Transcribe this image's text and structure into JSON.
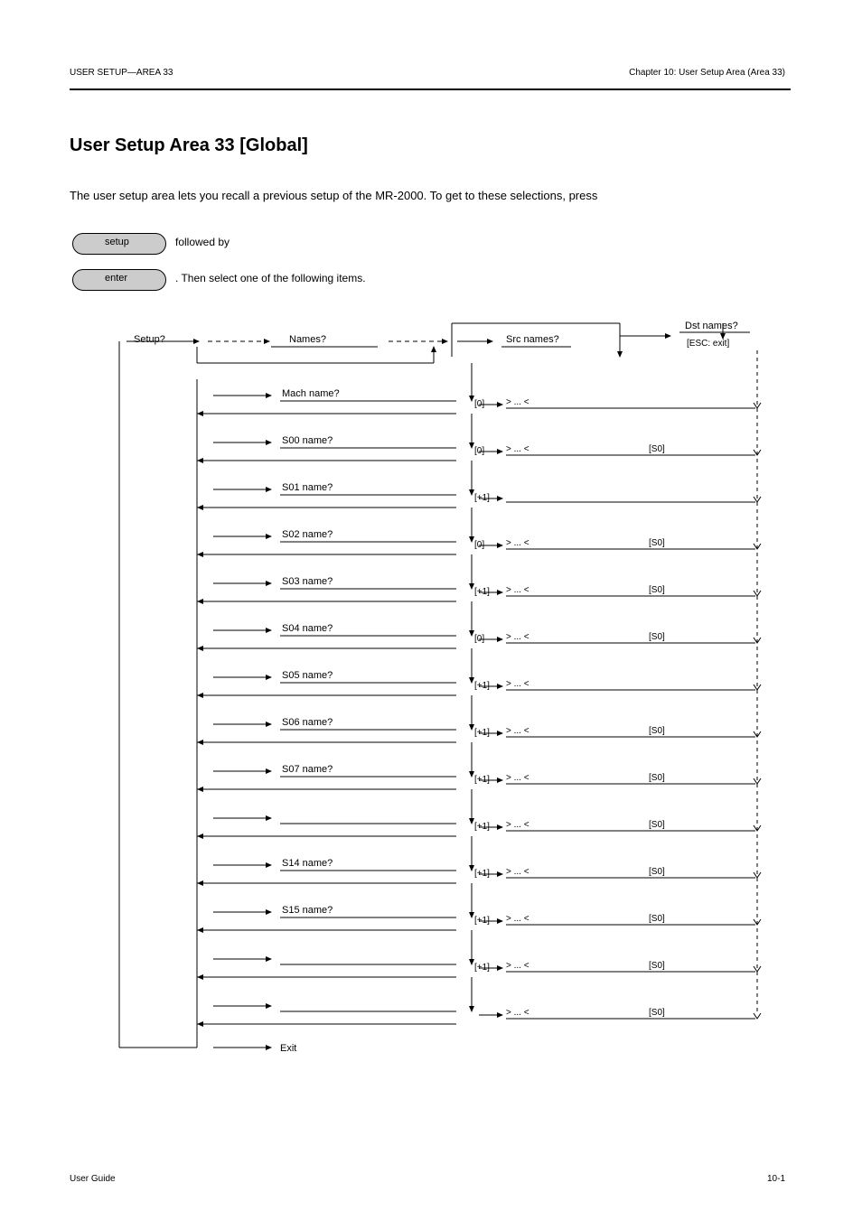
{
  "header_left": "USER SETUP—AREA 33",
  "header_right": "Chapter 10: User Setup Area (Area 33)",
  "heading": "User Setup Area 33 [Global]",
  "intro": "The user setup area lets you recall a previous setup of the MR-2000. To get to these selections, press",
  "pill1": "setup",
  "pill2": "enter",
  "after_pill1": "followed by",
  "after_pill2": ". Then select one of the following items.",
  "setup_btn": "Setup?",
  "names_btn": "Names?",
  "top_r_up": "Src names?",
  "top_r_down": "Dst names?",
  "col2_hdr": "[ESC: exit]",
  "rows": [
    {
      "l": "Mach name?",
      "pos": "[0]",
      "r1": "> ... <",
      "r2": ""
    },
    {
      "l": "S00 name?",
      "pos": "[0]",
      "r1": "> ... <",
      "r2": "[S0]"
    },
    {
      "l": "S01 name?",
      "pos": "[+1]",
      "r1": "",
      "r2": ""
    },
    {
      "l": "S02 name?",
      "pos": "[0]",
      "r1": "> ... <",
      "r2": "[S0]"
    },
    {
      "l": "S03 name?",
      "pos": "[+1]",
      "r1": "> ... <",
      "r2": "[S0]"
    },
    {
      "l": "S04 name?",
      "pos": "[0]",
      "r1": "> ... <",
      "r2": "[S0]"
    },
    {
      "l": "S05 name?",
      "pos": "[+1]",
      "r1": "> ... <",
      "r2": ""
    },
    {
      "l": "S06 name?",
      "pos": "[+1]",
      "r1": "> ... <",
      "r2": "[S0]"
    },
    {
      "l": "S07 name?",
      "pos": "[+1]",
      "r1": "> ... <",
      "r2": "[S0]"
    },
    {
      "l": "",
      "pos": "[+1]",
      "r1": "> ... <",
      "r2": "[S0]"
    },
    {
      "l": "S14 name?",
      "pos": "[+1]",
      "r1": "> ... <",
      "r2": "[S0]"
    },
    {
      "l": "S15 name?",
      "pos": "[+1]",
      "r1": "> ... <",
      "r2": "[S0]"
    },
    {
      "l": "",
      "pos": "[+1]",
      "r1": "> ... <",
      "r2": "[S0]"
    },
    {
      "l": "",
      "pos": "",
      "r1": "> ... <",
      "r2": "[S0]"
    }
  ],
  "exit": "Exit",
  "footer_l": "User Guide",
  "footer_r": "10-1"
}
